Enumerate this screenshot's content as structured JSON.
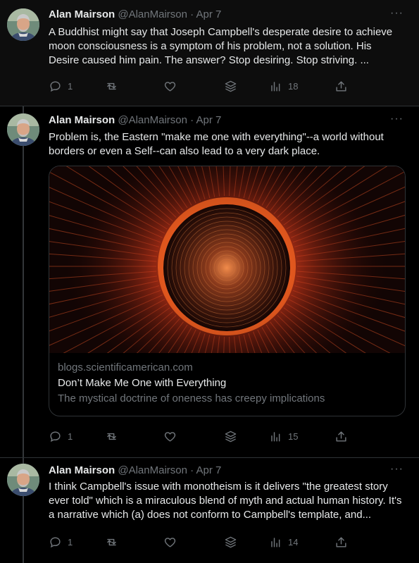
{
  "tweets": [
    {
      "name": "Alan Mairson",
      "handle": "@AlanMairson",
      "separator": "·",
      "date": "Apr 7",
      "text": "A Buddhist might say that Joseph Campbell's desperate desire to achieve moon consciousness is a symptom of his problem, not a solution. His Desire caused him pain. The answer? Stop desiring. Stop striving. ...",
      "replies": "1",
      "views": "18"
    },
    {
      "name": "Alan Mairson",
      "handle": "@AlanMairson",
      "separator": "·",
      "date": "Apr 7",
      "text": "Problem is, the Eastern \"make me one with everything\"--a world without borders or even a Self--can also lead to a very dark place.",
      "replies": "1",
      "views": "15",
      "card": {
        "domain": "blogs.scientificamerican.com",
        "title": "Don’t Make Me One with Everything",
        "description": "The mystical doctrine of oneness has creepy implications"
      }
    },
    {
      "name": "Alan Mairson",
      "handle": "@AlanMairson",
      "separator": "·",
      "date": "Apr 7",
      "text": "I think Campbell's issue with monotheism is it delivers \"the greatest story ever told\" which is a miraculous blend of myth and actual human history. It's a narrative which (a) does not conform to Campbell's template, and...",
      "replies": "1",
      "views": "14"
    }
  ],
  "icons": [
    "reply-icon",
    "retweet-icon",
    "like-icon",
    "bookmark-stack-icon",
    "views-icon",
    "share-icon",
    "more-icon"
  ],
  "colors": {
    "background": "#000000",
    "text": "#e7e9ea",
    "muted": "#71767b",
    "border": "#2f3336",
    "sun": "#e2541b"
  }
}
